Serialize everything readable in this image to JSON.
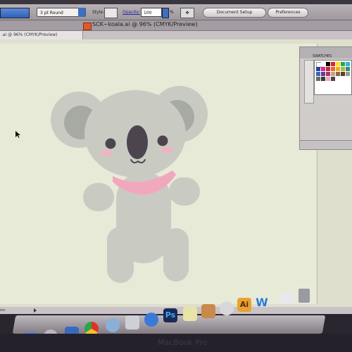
{
  "control_bar": {
    "brush": "3 pt Round",
    "style_label": "Style:",
    "opacity_label": "Opacity:",
    "opacity_value": "100",
    "percent": "%",
    "document_setup": "Document Setup",
    "preferences": "Preferences"
  },
  "window": {
    "title": "SCK~koala.ai @ 96% (CMYK/Preview)",
    "tab": ".ai @ 96% (CMYK/Preview)"
  },
  "panel": {
    "tab_label": "SWATCHES"
  },
  "status": {
    "text": "ion"
  },
  "artwork": {
    "body_color": "#c9cbc3",
    "ear_inner_color": "#a7a9a3",
    "nose_color": "#4c4550",
    "cheek_color": "#f0b3c0",
    "scarf_color": "#f2a8bc"
  },
  "dock": {
    "app_icon_photoshop": "Ps",
    "app_icon_illustrator": "Ai",
    "app_icon_word": "W"
  },
  "laptop": {
    "brand": "MacBook Pro"
  }
}
